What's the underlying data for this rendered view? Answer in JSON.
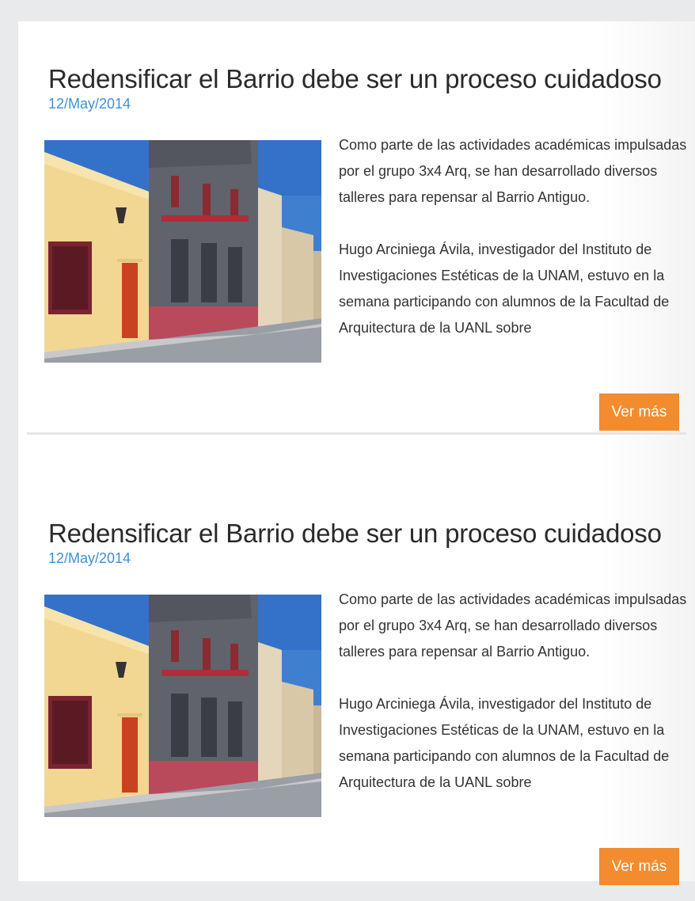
{
  "posts": [
    {
      "title": "Redensificar el Barrio debe ser un proceso cuidadoso",
      "date": "12/May/2014",
      "paragraph1": "Como parte de las actividades académicas impulsadas por el grupo 3x4 Arq, se han desarrollado diversos talleres para repensar al Barrio Antiguo.",
      "paragraph2": "Hugo Arciniega Ávila, investigador del Instituto de Investigaciones Estéticas de la UNAM, estuvo en la semana participando con alumnos de la Facultad de Arquitectura de la UANL sobre",
      "button_label": "Ver más"
    },
    {
      "title": "Redensificar el Barrio debe ser un proceso cuidadoso",
      "date": "12/May/2014",
      "paragraph1": "Como parte de las actividades académicas impulsadas por el grupo 3x4 Arq, se han desarrollado diversos talleres para repensar al Barrio Antiguo.",
      "paragraph2": "Hugo Arciniega Ávila, investigador del Instituto de Investigaciones Estéticas de la UNAM, estuvo en la semana participando con alumnos de la Facultad de Arquitectura de la UANL sobre",
      "button_label": "Ver más"
    }
  ],
  "colors": {
    "date": "#3f8fd6",
    "button": "#f28c2e",
    "title": "#2a2a2a",
    "body_text": "#333333"
  }
}
